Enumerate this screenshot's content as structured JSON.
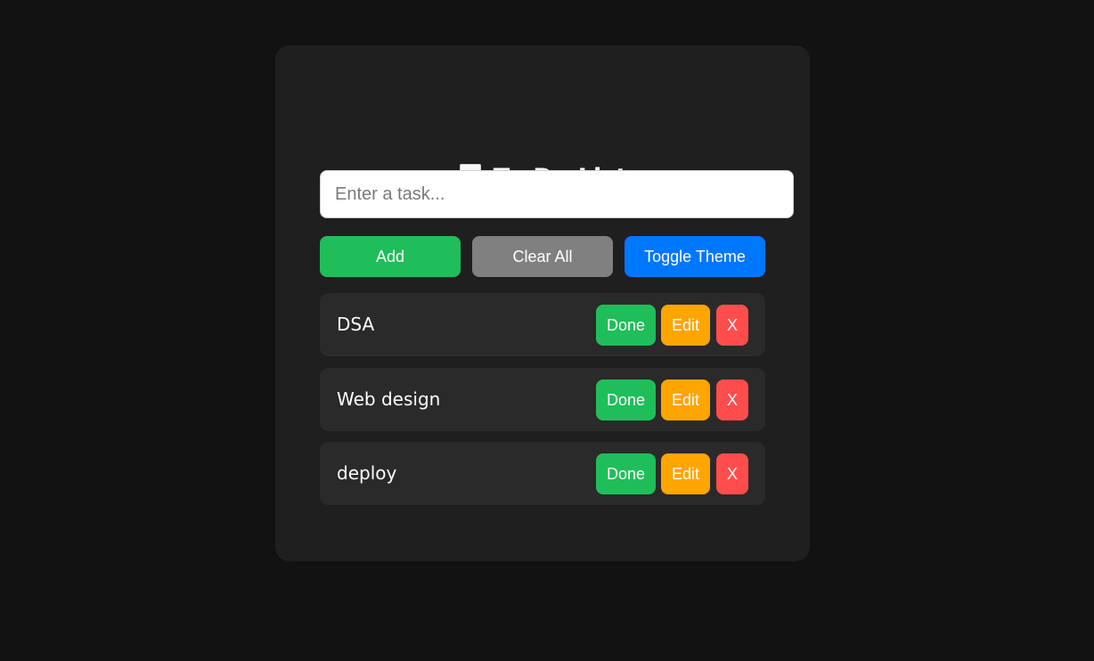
{
  "app": {
    "title": "To-Do List",
    "title_icon": "memo-icon"
  },
  "input": {
    "value": "",
    "placeholder": "Enter a task..."
  },
  "controls": {
    "add_label": "Add",
    "clear_label": "Clear All",
    "toggle_theme_label": "Toggle Theme"
  },
  "tasks": [
    {
      "text": "DSA",
      "done_label": "Done",
      "edit_label": "Edit",
      "delete_label": "X"
    },
    {
      "text": "Web design",
      "done_label": "Done",
      "edit_label": "Edit",
      "delete_label": "X"
    },
    {
      "text": "deploy",
      "done_label": "Done",
      "edit_label": "Edit",
      "delete_label": "X"
    }
  ],
  "colors": {
    "page_background": "#121212",
    "card_background": "#1f1f1f",
    "task_background": "#2a2a2a",
    "add_button": "#1fbe5a",
    "clear_button": "#808080",
    "toggle_theme_button": "#0077ff",
    "done_button": "#1fbe5a",
    "edit_button": "#ffa500",
    "delete_button": "#ff4d4d"
  }
}
